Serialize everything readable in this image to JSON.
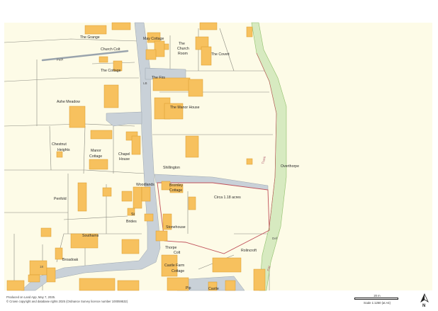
{
  "map": {
    "labels": {
      "the_grange": "The Grange",
      "may_cottage": "May Cottage",
      "church_colt": "Church Colt",
      "the_church_room_1": "The",
      "the_church_room_2": "Church",
      "the_church_room_3": "Room",
      "the_covert": "The Covert",
      "path": "Path",
      "the_cottage": "The Cottage",
      "the_firs": "The Firs",
      "lb": "LB",
      "ashe_meadow": "Ashe Meadow",
      "the_manor_house": "The Manor House",
      "chestnut": "Chestnut",
      "heights": "Heights",
      "manor": "Manor",
      "cottage": "Cottage",
      "chapel": "Chapel",
      "house": "House",
      "shillington": "Shillington",
      "overthorpe": "Overthorpe",
      "track": "Track",
      "woodlands": "Woodlands",
      "bromley": "Bromley",
      "bromley_cottage": "Cottage",
      "penfold": "Penfold",
      "circa": "Circa 1.18 acres",
      "st": "St",
      "brides": "Brides",
      "stonehouse": "Stonehouse",
      "southams": "Southams",
      "def": "Def",
      "thorpe": "Thorpe",
      "colt": "Colt",
      "rolincroft": "Rolincroft",
      "broadoak": "Broadoak",
      "castle_farm": "Castle Farm",
      "castle_farm_cottage": "Cottage",
      "pip": "Pip",
      "castle": "Castle",
      "num_18": "18",
      "pw": "PW"
    }
  },
  "footer": {
    "line1": "Produced on Land App, May 7, 2025.",
    "line2": "© Crown copyright and database rights 2025 (Ordnance Survey licence number 100059532)"
  },
  "scale": {
    "distance": "20 m",
    "text": "Scale 1:1250 (at A4)"
  },
  "north": {
    "letter": "N"
  },
  "colors": {
    "building": "#f7c15e",
    "building_stroke": "#d89a2a",
    "land": "#fdfbe7",
    "road": "#c9d1d8",
    "boundary": "#c0505a",
    "green_strip": "#d7eac0"
  }
}
